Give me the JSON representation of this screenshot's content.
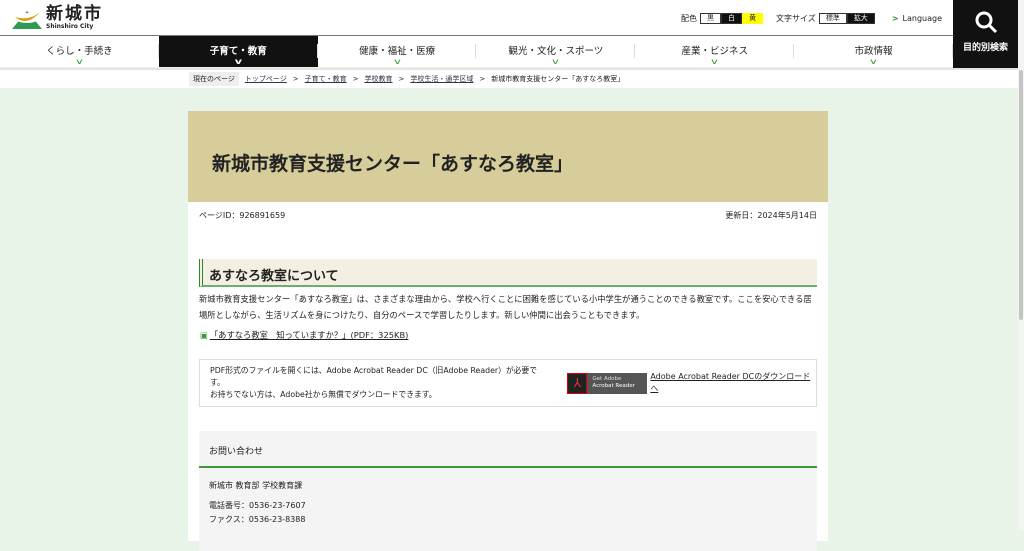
{
  "logo": {
    "name": "新城市",
    "sub": "Shinshiro City"
  },
  "tools": {
    "color_label": "配色",
    "colors": [
      "黒",
      "白",
      "黄"
    ],
    "size_label": "文字サイズ",
    "sizes": [
      "標準",
      "拡大"
    ],
    "language": "Language"
  },
  "search": {
    "label": "目的別検索"
  },
  "nav": [
    "くらし・手続き",
    "子育て・教育",
    "健康・福祉・医療",
    "観光・文化・スポーツ",
    "産業・ビジネス",
    "市政情報"
  ],
  "breadcrumb": {
    "current_label": "現在のページ",
    "items": [
      "トップページ",
      "子育て・教育",
      "学校教育",
      "学校生活・通学区域"
    ],
    "current": "新城市教育支援センター「あすなろ教室」"
  },
  "page": {
    "title": "新城市教育支援センター「あすなろ教室」",
    "page_id": "ページID：926891659",
    "updated": "更新日：2024年5月14日",
    "section_title": "あすなろ教室について",
    "body": "新城市教育支援センター「あすなろ教室」は、さまざまな理由から、学校へ行くことに困難を感じている小中学生が通うことのできる教室です。ここを安心できる居場所としながら、生活リズムを身につけたり、自分のペースで学習したりします。新しい仲間に出会うこともできます。",
    "pdf_link": "「あすなろ教室　知っていますか？」(PDF：325KB)"
  },
  "acrobat": {
    "line1": "PDF形式のファイルを開くには、Adobe Acrobat Reader DC（旧Adobe Reader）が必要です。",
    "line2": "お持ちでない方は、Adobe社から無償でダウンロードできます。",
    "badge_top": "Get Adobe",
    "badge_bottom": "Acrobat Reader",
    "link": "Adobe Acrobat Reader DCのダウンロードへ"
  },
  "contact": {
    "title": "お問い合わせ",
    "org": "新城市 教育部 学校教育課",
    "tel": "電話番号：0536-23-7607",
    "fax": "ファクス：0536-23-8388"
  }
}
